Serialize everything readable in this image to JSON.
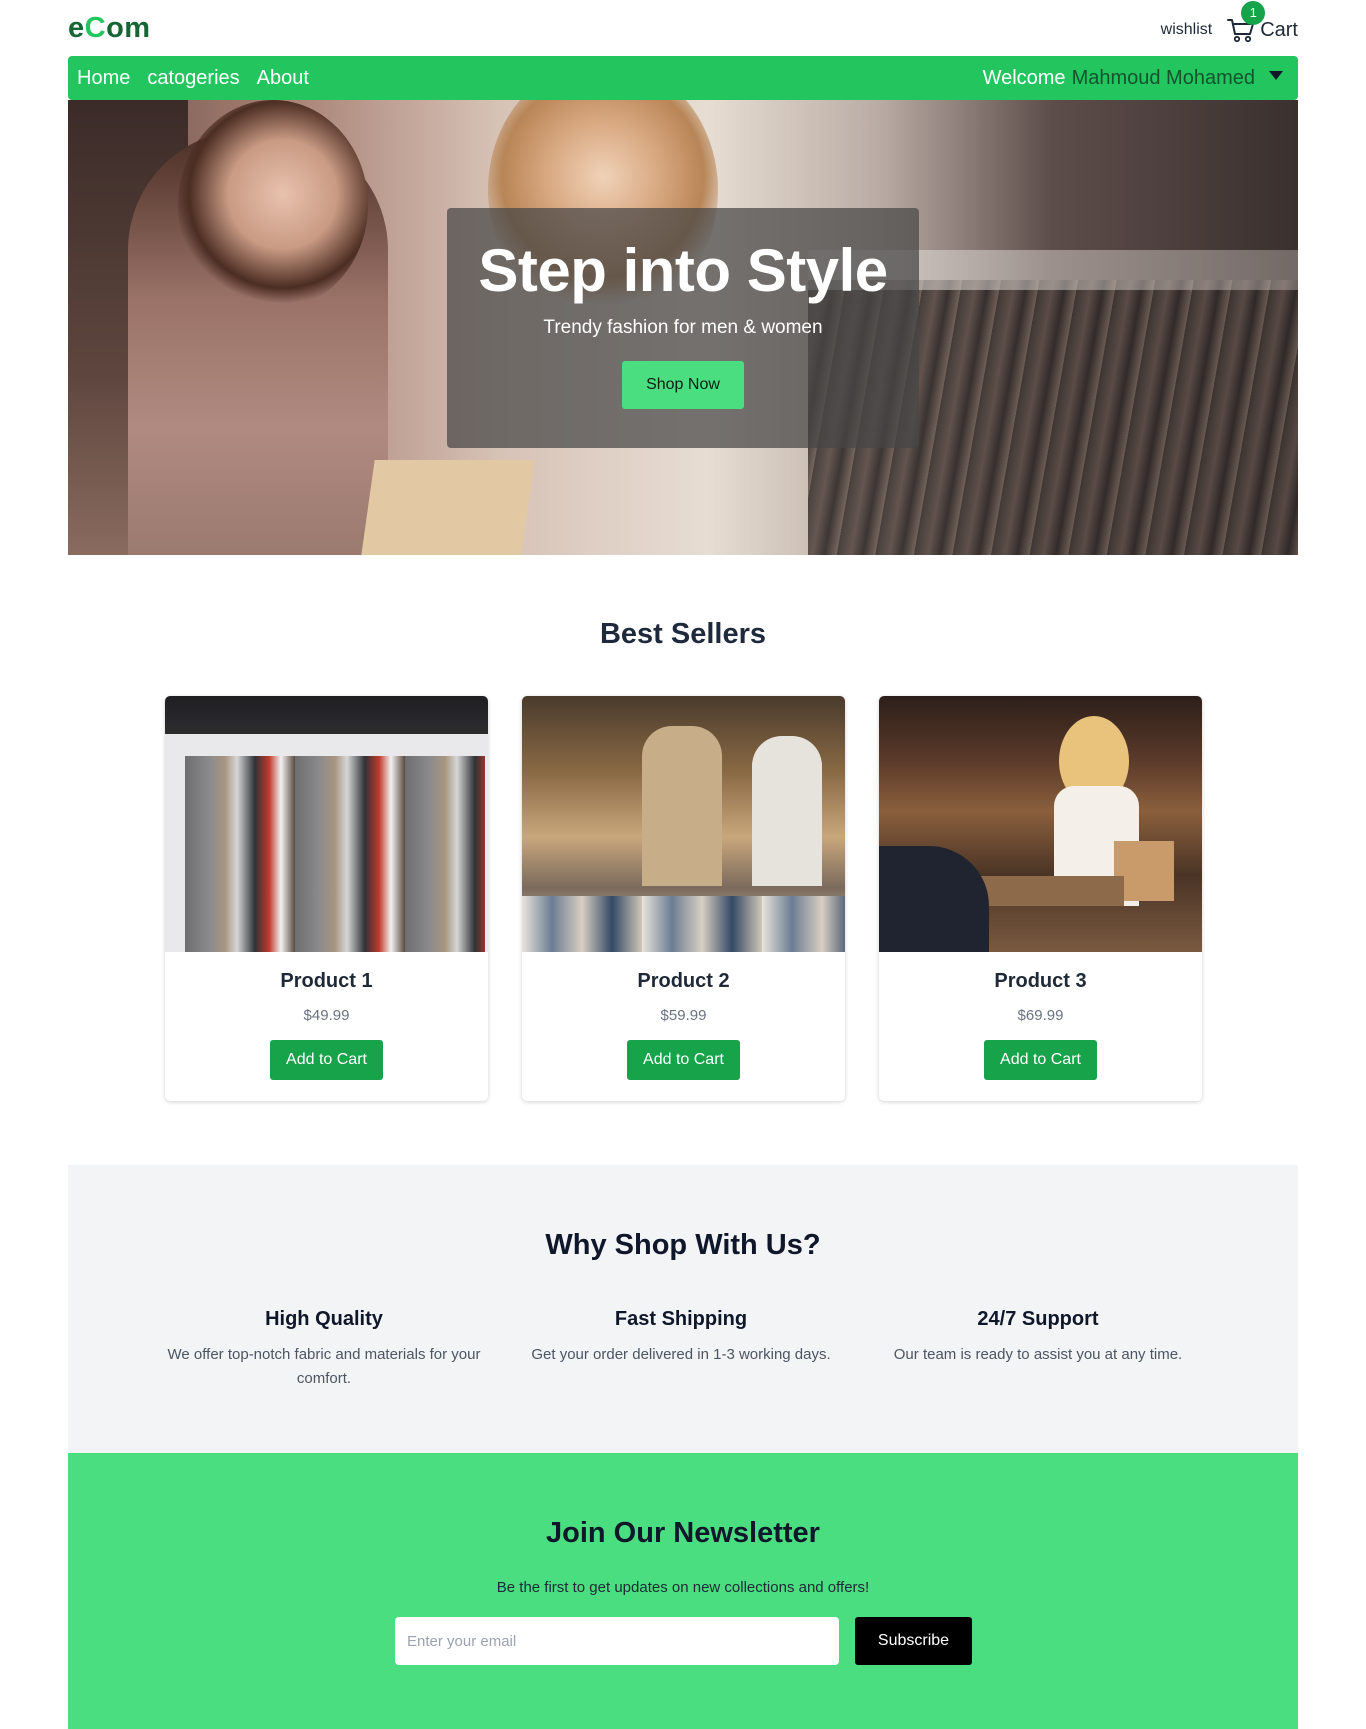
{
  "header": {
    "logo_prefix": "e",
    "logo_accent": "C",
    "logo_suffix": "om",
    "wishlist_label": "wishlist",
    "cart_count": "1",
    "cart_label": "Cart"
  },
  "nav": {
    "links": [
      "Home",
      "catogeries",
      "About"
    ],
    "welcome_label": "Welcome",
    "username": "Mahmoud Mohamed"
  },
  "hero": {
    "title": "Step into Style",
    "subtitle": "Trendy fashion for men & women",
    "cta_label": "Shop Now"
  },
  "best_sellers": {
    "title": "Best Sellers",
    "products": [
      {
        "name": "Product 1",
        "price": "$49.99",
        "button": "Add to Cart"
      },
      {
        "name": "Product 2",
        "price": "$59.99",
        "button": "Add to Cart"
      },
      {
        "name": "Product 3",
        "price": "$69.99",
        "button": "Add to Cart"
      }
    ]
  },
  "why": {
    "title": "Why Shop With Us?",
    "features": [
      {
        "title": "High Quality",
        "text": "We offer top-notch fabric and materials for your comfort."
      },
      {
        "title": "Fast Shipping",
        "text": "Get your order delivered in 1-3 working days."
      },
      {
        "title": "24/7 Support",
        "text": "Our team is ready to assist you at any time."
      }
    ]
  },
  "newsletter": {
    "title": "Join Our Newsletter",
    "subtitle": "Be the first to get updates on new collections and offers!",
    "email_placeholder": "Enter your email",
    "subscribe_label": "Subscribe"
  },
  "colors": {
    "brand_green": "#22c55e",
    "button_green": "#16a34a",
    "light_green": "#4ade80",
    "dark_green": "#166534"
  },
  "icons": [
    "cart-icon",
    "chevron-down-icon"
  ]
}
